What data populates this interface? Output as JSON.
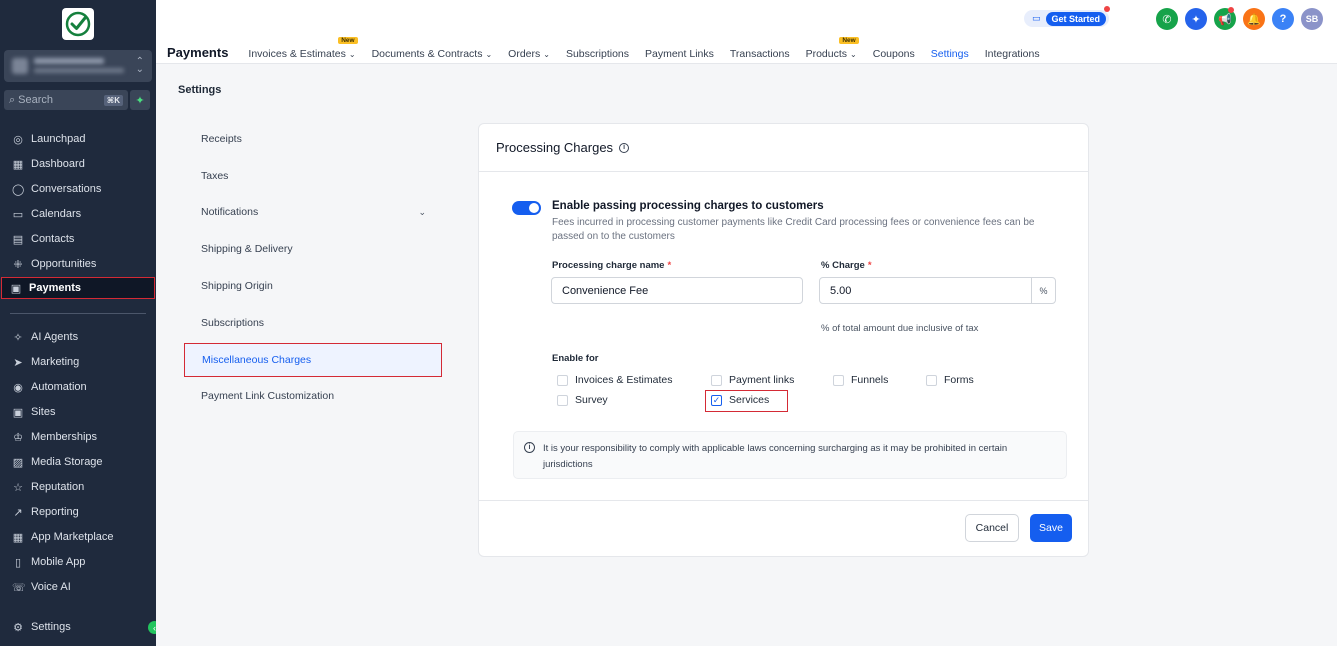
{
  "sidebar": {
    "logo": "checkmark-logo",
    "search": {
      "placeholder": "Search",
      "shortcut": "⌘K"
    },
    "items": [
      {
        "label": "Launchpad",
        "icon": "launchpad-icon"
      },
      {
        "label": "Dashboard",
        "icon": "dashboard-icon"
      },
      {
        "label": "Conversations",
        "icon": "conversations-icon"
      },
      {
        "label": "Calendars",
        "icon": "calendar-icon"
      },
      {
        "label": "Contacts",
        "icon": "contacts-icon"
      },
      {
        "label": "Opportunities",
        "icon": "opportunities-icon"
      },
      {
        "label": "Payments",
        "icon": "payments-icon",
        "active": true
      },
      {
        "label": "AI Agents",
        "icon": "ai-agents-icon"
      },
      {
        "label": "Marketing",
        "icon": "marketing-icon"
      },
      {
        "label": "Automation",
        "icon": "automation-icon"
      },
      {
        "label": "Sites",
        "icon": "sites-icon"
      },
      {
        "label": "Memberships",
        "icon": "memberships-icon"
      },
      {
        "label": "Media Storage",
        "icon": "media-storage-icon"
      },
      {
        "label": "Reputation",
        "icon": "reputation-icon"
      },
      {
        "label": "Reporting",
        "icon": "reporting-icon"
      },
      {
        "label": "App Marketplace",
        "icon": "app-marketplace-icon"
      },
      {
        "label": "Mobile App",
        "icon": "mobile-app-icon"
      },
      {
        "label": "Voice AI",
        "icon": "voice-ai-icon"
      },
      {
        "label": "Settings",
        "icon": "settings-icon"
      }
    ]
  },
  "topbar": {
    "brand": "Payments",
    "tabs": [
      {
        "label": "Invoices & Estimates",
        "new": "New",
        "dropdown": true
      },
      {
        "label": "Documents & Contracts",
        "dropdown": true
      },
      {
        "label": "Orders",
        "dropdown": true
      },
      {
        "label": "Subscriptions"
      },
      {
        "label": "Payment Links"
      },
      {
        "label": "Transactions"
      },
      {
        "label": "Products",
        "new": "New",
        "dropdown": true
      },
      {
        "label": "Coupons"
      },
      {
        "label": "Settings",
        "active": true
      },
      {
        "label": "Integrations"
      }
    ],
    "get_started": "Get Started",
    "avatar_initials": "SB",
    "colors": {
      "accent": "#155eef"
    }
  },
  "settings": {
    "title": "Settings",
    "nav": [
      {
        "label": "Receipts"
      },
      {
        "label": "Taxes"
      },
      {
        "label": "Notifications",
        "expandable": true
      },
      {
        "label": "Shipping & Delivery"
      },
      {
        "label": "Shipping Origin"
      },
      {
        "label": "Subscriptions"
      },
      {
        "label": "Miscellaneous Charges",
        "active": true
      },
      {
        "label": "Payment Link Customization"
      }
    ]
  },
  "card": {
    "title": "Processing Charges",
    "toggle": {
      "enabled": true,
      "title": "Enable passing processing charges to customers",
      "description": "Fees incurred in processing customer payments like Credit Card processing fees or convenience fees can be passed on to the customers"
    },
    "charge_name": {
      "label": "Processing charge name",
      "required": "*",
      "value": "Convenience Fee"
    },
    "charge_pct": {
      "label": "% Charge",
      "required": "*",
      "value": "5.00",
      "suffix": "%",
      "hint": "% of total amount due inclusive of tax"
    },
    "enable_for": {
      "label": "Enable for",
      "options": [
        {
          "label": "Invoices & Estimates",
          "checked": false
        },
        {
          "label": "Payment links",
          "checked": false
        },
        {
          "label": "Funnels",
          "checked": false
        },
        {
          "label": "Forms",
          "checked": false
        },
        {
          "label": "Survey",
          "checked": false
        },
        {
          "label": "Services",
          "checked": true
        }
      ]
    },
    "notice": "It is your responsibility to comply with applicable laws concerning surcharging as it may be prohibited in certain jurisdictions",
    "cancel_label": "Cancel",
    "save_label": "Save"
  }
}
